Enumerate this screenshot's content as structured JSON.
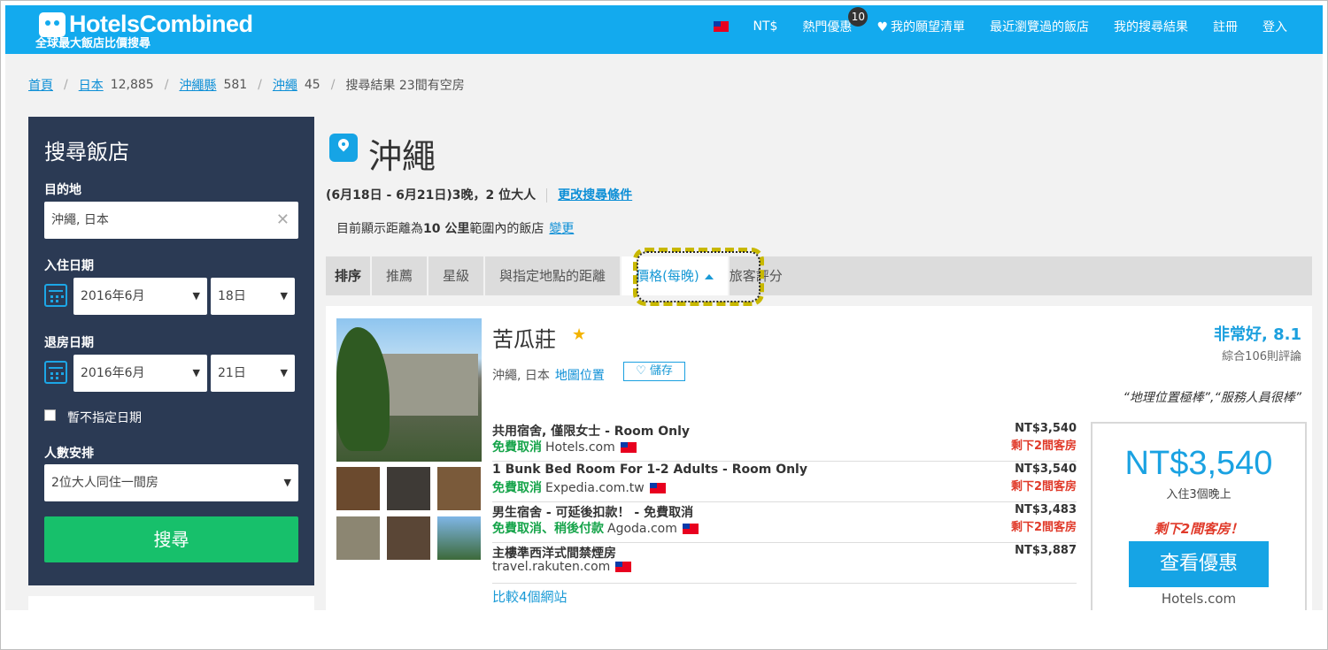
{
  "header": {
    "logo_text": "HotelsCombined",
    "logo_sub": "全球最大飯店比價搜尋",
    "currency": "NT$",
    "deals": "熱門優惠",
    "deals_count": "10",
    "wishlist": "我的願望清單",
    "recent": "最近瀏覽過的飯店",
    "my_search": "我的搜尋結果",
    "register": "註冊",
    "login": "登入"
  },
  "breadcrumb": {
    "home": "首頁",
    "japan": "日本",
    "japan_count": "12,885",
    "pref": "沖繩縣",
    "pref_count": "581",
    "city": "沖繩",
    "city_count": "45",
    "current": "搜尋結果 23間有空房"
  },
  "sidebar": {
    "title": "搜尋飯店",
    "dest_label": "目的地",
    "dest_value": "沖繩, 日本",
    "checkin_label": "入住日期",
    "checkin_month": "2016年6月",
    "checkin_day": "18日",
    "checkout_label": "退房日期",
    "checkout_month": "2016年6月",
    "checkout_day": "21日",
    "no_date_label": "暫不指定日期",
    "guests_label": "人數安排",
    "guests_value": "2位大人同住一間房",
    "search_btn": "搜尋"
  },
  "main": {
    "city": "沖繩",
    "dates": "(6月18日 - 6月21日)3晚，2 位大人",
    "change_search": "更改搜尋條件",
    "distance_pre": "目前顯示距離為",
    "distance_val": "10 公里",
    "distance_post": "範圍內的飯店",
    "distance_change": "變更"
  },
  "sort": {
    "label": "排序",
    "recommended": "推薦",
    "stars": "星級",
    "distance": "與指定地點的距離",
    "price": "價格(每晚)",
    "rating": "旅客評分"
  },
  "hotel": {
    "name": "苦瓜莊",
    "location": "沖繩, 日本",
    "map_link": "地圖位置",
    "save": "儲存",
    "score": "非常好, 8.1",
    "reviews": "綜合106則評論",
    "quote": "“地理位置極棒”,“服務人員很棒”",
    "deals": [
      {
        "room": "共用宿舍, 僅限女士 - Room Only",
        "free": "免費取消",
        "site": "Hotels.com",
        "price": "NT$3,540",
        "left": "剩下2間客房"
      },
      {
        "room": "1 Bunk Bed Room For 1-2 Adults - Room Only",
        "free": "免費取消",
        "site": "Expedia.com.tw",
        "price": "NT$3,540",
        "left": "剩下2間客房"
      },
      {
        "room": "男生宿舍 - 可延後扣款！ - 免費取消",
        "free": "免費取消、稍後付款",
        "site": "Agoda.com",
        "price": "NT$3,483",
        "left": "剩下2間客房"
      },
      {
        "room": "主樓準西洋式間禁煙房",
        "free": "",
        "site": "travel.rakuten.com",
        "price": "NT$3,887",
        "left": ""
      }
    ],
    "compare": "比較4個網站",
    "best_price": "NT$3,540",
    "min_stay": "入住3個晚上",
    "rooms_left": "剩下2間客房！",
    "view_deal": "查看優惠",
    "best_site": "Hotels.com"
  },
  "colors": {
    "brand_blue": "#13aaee",
    "sidebar_navy": "#2b3a54",
    "search_green": "#17c06b",
    "alert_red": "#e03a2a"
  }
}
